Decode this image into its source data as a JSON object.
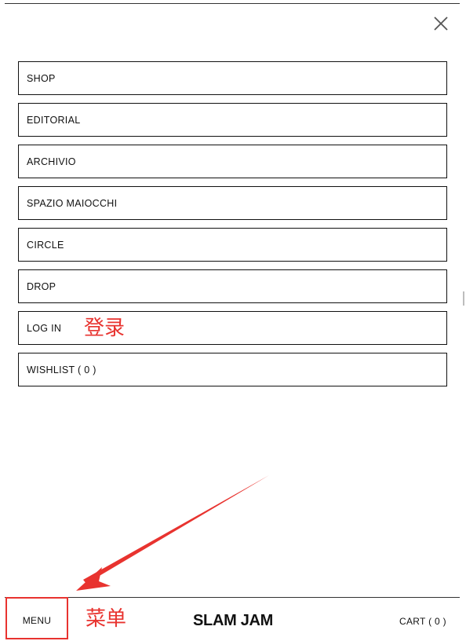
{
  "menu": {
    "items": [
      {
        "label": "SHOP"
      },
      {
        "label": "EDITORIAL"
      },
      {
        "label": "ARCHIVIO"
      },
      {
        "label": "SPAZIO MAIOCCHI"
      },
      {
        "label": "CIRCLE"
      },
      {
        "label": "DROP"
      },
      {
        "label": "LOG IN"
      },
      {
        "label": "WISHLIST ( 0 )"
      }
    ],
    "close_icon": "close-icon"
  },
  "annotations": {
    "login_note": "登录",
    "menu_note": "菜单",
    "color": "#e8332f"
  },
  "bottom_bar": {
    "menu_label": "MENU",
    "brand": "SLAM JAM",
    "cart_label": "CART ( 0 )"
  }
}
